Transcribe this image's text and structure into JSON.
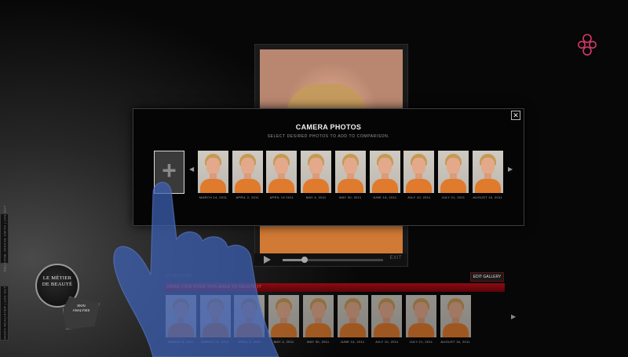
{
  "modal": {
    "title": "CAMERA PHOTOS",
    "subtitle": "SELECT DESIRED PHOTOS TO ADD TO COMPARISON.",
    "close_label": "✕",
    "add_label": "+",
    "prev_label": "◀",
    "next_label": "▶",
    "photos": [
      {
        "date": "MARCH 14, 2011"
      },
      {
        "date": "APRIL 2, 2011"
      },
      {
        "date": "APRIL 19 2011"
      },
      {
        "date": "MAY 4, 2011"
      },
      {
        "date": "MAY 30, 2011"
      },
      {
        "date": "JUNE 16, 2011"
      },
      {
        "date": "JULY 10, 2011"
      },
      {
        "date": "JULY 21, 2011"
      },
      {
        "date": "AUGUST 16, 2011"
      }
    ]
  },
  "viewer": {
    "play_label": "▶",
    "exit_label": "EXIT",
    "progress": 0.22
  },
  "gallery": {
    "count_label": "10 PHOTOS",
    "edit_label": "EDIT GALLERY",
    "delete_hint": "DRAG ITEM OVER THIS AREA TO DELETE IT",
    "next_label": "▶",
    "photos": [
      {
        "date": "MARCH 8, 2011"
      },
      {
        "date": "MARCH 14, 2011"
      },
      {
        "date": "APRIL 2, 2011"
      },
      {
        "date": "MAY 4, 2011"
      },
      {
        "date": "MAY 30, 2011"
      },
      {
        "date": "JUNE 16, 2011"
      },
      {
        "date": "JULY 10, 2011"
      },
      {
        "date": "JULY 21, 2011"
      },
      {
        "date": "AUGUST 16, 2011"
      }
    ]
  },
  "sidebar": {
    "top_label": "WELCOME JOANNE SMITH  |  LOG OUT",
    "bottom_label": "JASON MCALISTER  |  LOG OUT"
  },
  "logo": {
    "line1": "LE MÉTIER",
    "line2": "DE BEAUTÉ"
  },
  "skin_button": {
    "line1": "SKIN",
    "line2": "ANALYSIS"
  },
  "colors": {
    "accent_red": "#8d0b12",
    "brand_pink": "#d63a6a",
    "shirt_orange": "#e07a2c"
  },
  "icons": {
    "brand": "quatrefoil-logo-icon",
    "hand": "hand-pointer-icon"
  }
}
